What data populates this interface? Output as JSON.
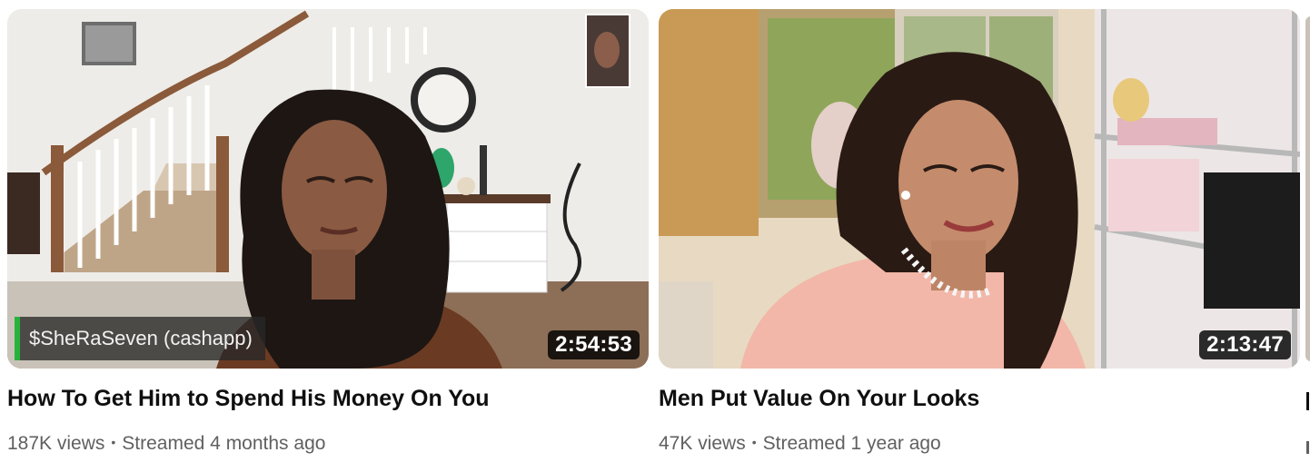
{
  "videos": [
    {
      "title": "How To Get Him to Spend His Money On You",
      "views": "187K views",
      "time": "Streamed 4 months ago",
      "duration": "2:54:53",
      "overlay_text": "$SheRaSeven (cashapp)"
    },
    {
      "title": "Men Put Value On Your Looks",
      "views": "47K views",
      "time": "Streamed 1 year ago",
      "duration": "2:13:47"
    }
  ],
  "separator": "•"
}
